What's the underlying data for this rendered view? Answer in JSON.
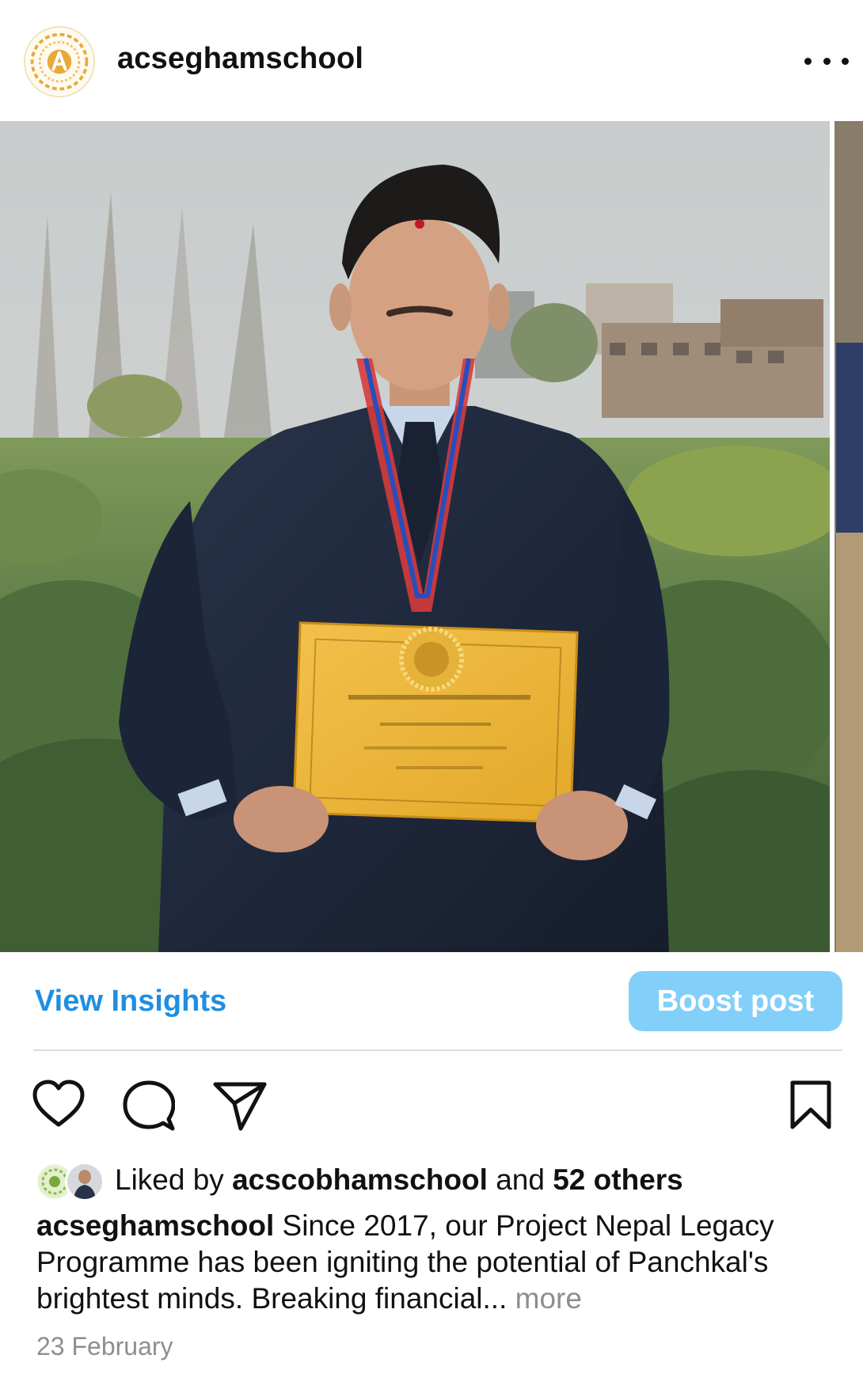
{
  "post": {
    "username": "acseghamschool",
    "more_menu": "more-options-icon",
    "view_insights": "View Insights",
    "boost_post": "Boost post",
    "likes": {
      "prefix": "Liked by",
      "user": "acscobhamschool",
      "middle": "and",
      "others": "52 others"
    },
    "caption": {
      "user": "acseghamschool",
      "text": "Since 2017, our Project Nepal Legacy Programme has been igniting the potential of Panchkal's brightest minds. Breaking financial...",
      "more": "more"
    },
    "date": "23 February"
  },
  "icons": [
    "like-heart-icon",
    "comment-bubble-icon",
    "share-send-icon",
    "bookmark-icon"
  ],
  "colors": {
    "link_blue": "#1f8ee2",
    "boost_bg": "#82cffa",
    "muted": "#8e8e8e",
    "logo_gold": "#e9a93a"
  }
}
